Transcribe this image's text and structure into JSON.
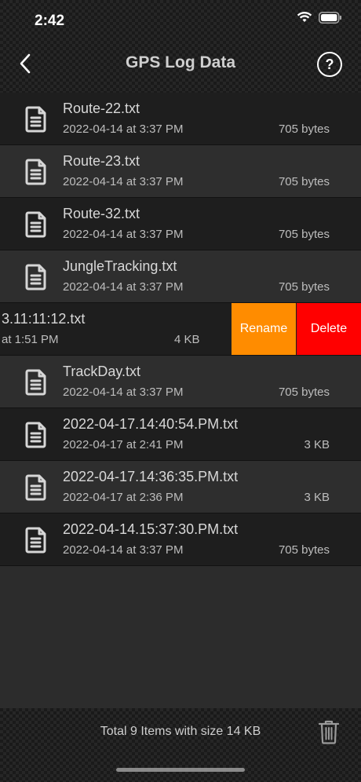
{
  "status_bar": {
    "time": "2:42"
  },
  "nav": {
    "title": "GPS Log Data",
    "help_label": "?"
  },
  "rows": [
    {
      "name": "Route-22.txt",
      "date": "2022-04-14 at 3:37 PM",
      "size": "705 bytes"
    },
    {
      "name": "Route-23.txt",
      "date": "2022-04-14 at 3:37 PM",
      "size": "705 bytes"
    },
    {
      "name": "Route-32.txt",
      "date": "2022-04-14 at 3:37 PM",
      "size": "705 bytes"
    },
    {
      "name": "JungleTracking.txt",
      "date": "2022-04-14 at 3:37 PM",
      "size": "705 bytes"
    },
    {
      "name": "3.11:11:12.txt",
      "date": "at 1:51 PM",
      "size": "4 KB"
    },
    {
      "name": "TrackDay.txt",
      "date": "2022-04-14 at 3:37 PM",
      "size": "705 bytes"
    },
    {
      "name": "2022-04-17.14:40:54.PM.txt",
      "date": "2022-04-17 at 2:41 PM",
      "size": "3 KB"
    },
    {
      "name": "2022-04-17.14:36:35.PM.txt",
      "date": "2022-04-17 at 2:36 PM",
      "size": "3 KB"
    },
    {
      "name": "2022-04-14.15:37:30.PM.txt",
      "date": "2022-04-14 at 3:37 PM",
      "size": "705 bytes"
    }
  ],
  "swipe_actions": {
    "rename": "Rename",
    "delete": "Delete"
  },
  "footer": {
    "summary": "Total 9 Items with size 14 KB"
  },
  "icons": {
    "back": "chevron-left-icon",
    "help": "question-circle-icon",
    "file": "document-icon",
    "trash": "trash-icon"
  },
  "colors": {
    "rename": "#ff8c00",
    "delete": "#ff0000",
    "background": "#2c2c2c"
  }
}
